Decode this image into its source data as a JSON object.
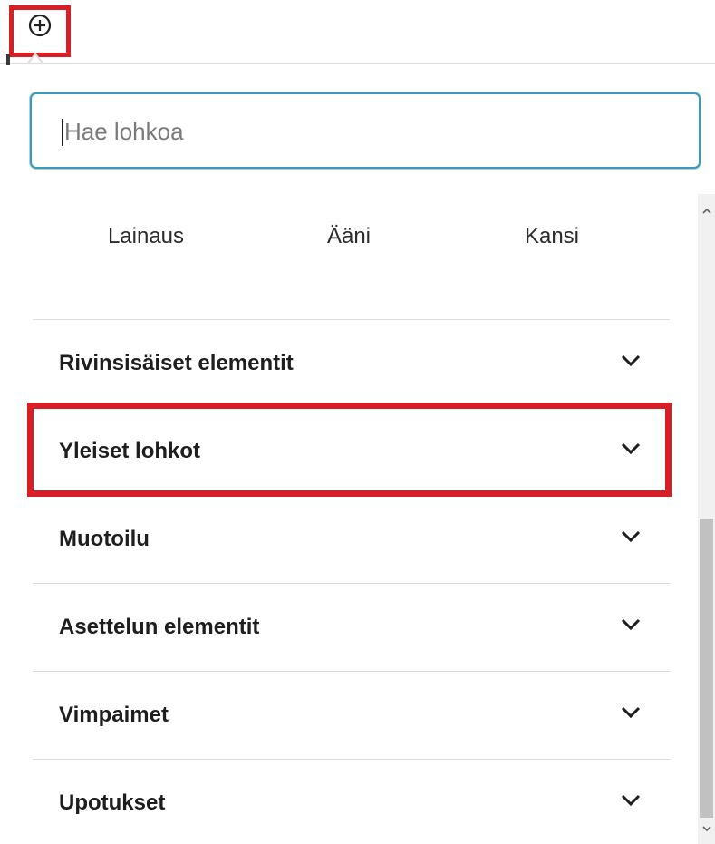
{
  "toolbar": {
    "inserter_icon": "plus-circle-icon"
  },
  "search": {
    "placeholder": "Hae lohkoa",
    "value": ""
  },
  "blocks": [
    {
      "label": "Lainaus"
    },
    {
      "label": "Ääni"
    },
    {
      "label": "Kansi"
    }
  ],
  "categories": [
    {
      "label": "Rivinsisäiset elementit",
      "expanded": false
    },
    {
      "label": "Yleiset lohkot",
      "expanded": false,
      "highlighted": true
    },
    {
      "label": "Muotoilu",
      "expanded": false
    },
    {
      "label": "Asettelun elementit",
      "expanded": false
    },
    {
      "label": "Vimpaimet",
      "expanded": false
    },
    {
      "label": "Upotukset",
      "expanded": false
    }
  ],
  "colors": {
    "highlight": "#d81f26",
    "focus_border": "#3c9ab5"
  }
}
